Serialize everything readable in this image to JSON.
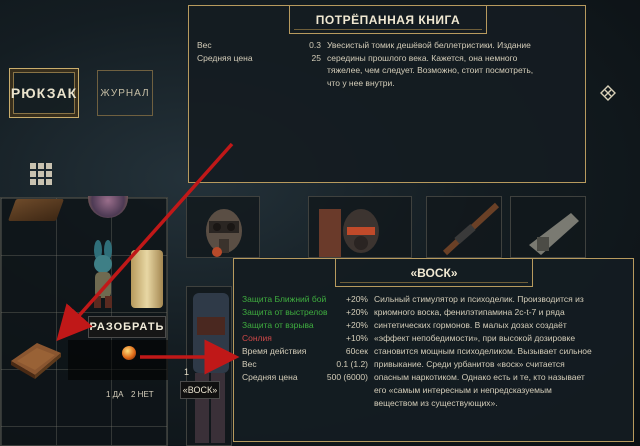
{
  "tabs": {
    "backpack": "РЮКЗАК",
    "journal": "ЖУРНАЛ"
  },
  "backpack": {
    "disassemble_label": "РАЗОБРАТЬ",
    "quantity_yes": "1 ДА",
    "quantity_no": "2 НЕТ"
  },
  "equipped": {
    "count": "1",
    "label": "«ВОСК»"
  },
  "book_panel": {
    "title": "ПОТРЁПАННАЯ КНИГА",
    "stats": [
      {
        "label": "Вес",
        "value": "0.3"
      },
      {
        "label": "Средняя цена",
        "value": "25"
      }
    ],
    "description": [
      "Увесистый томик дешёвой беллетристики. Издание",
      "середины прошлого века. Кажется, она немного",
      "тяжелее, чем следует. Возможно, стоит посмотреть,",
      "что у нее внутри."
    ]
  },
  "wax_panel": {
    "title": "«ВОСК»",
    "stats": [
      {
        "label": "Защита Ближний бой",
        "value": "+20%",
        "color": "#3fae3f"
      },
      {
        "label": "Защита от выстрелов",
        "value": "+20%",
        "color": "#3fae3f"
      },
      {
        "label": "Защита от взрыва",
        "value": "+20%",
        "color": "#3fae3f"
      },
      {
        "label": "Сонлия",
        "value": "+10%",
        "color": "#d04848"
      },
      {
        "label": "Время действия",
        "value": "60сек",
        "color": "#d4cdb9"
      },
      {
        "label": "Вес",
        "value": "0.1 (1.2)",
        "color": "#d4cdb9"
      },
      {
        "label": "Средняя цена",
        "value": "500 (6000)",
        "color": "#d4cdb9"
      }
    ],
    "description": [
      "Сильный стимулятор и психоделик. Производится из",
      "криомного воска, фенилэтипамина 2c-t-7 и ряда",
      "синтетических гормонов. В малых дозах создаёт",
      "«эффект непобедимости», при высокой дозировке",
      "становится мощным психоделиком. Вызывает сильное",
      "привыкание. Среди урбанитов «воск» считается",
      "опасным наркотиком. Однако есть и те, кто называет",
      "его «самым интересным и непредсказуемым",
      "веществом из существующих»."
    ]
  },
  "colors": {
    "accent_gold": "#b79a5e",
    "arrow_red": "#c01818",
    "positive_green": "#3fae3f",
    "negative_red": "#d04848"
  }
}
